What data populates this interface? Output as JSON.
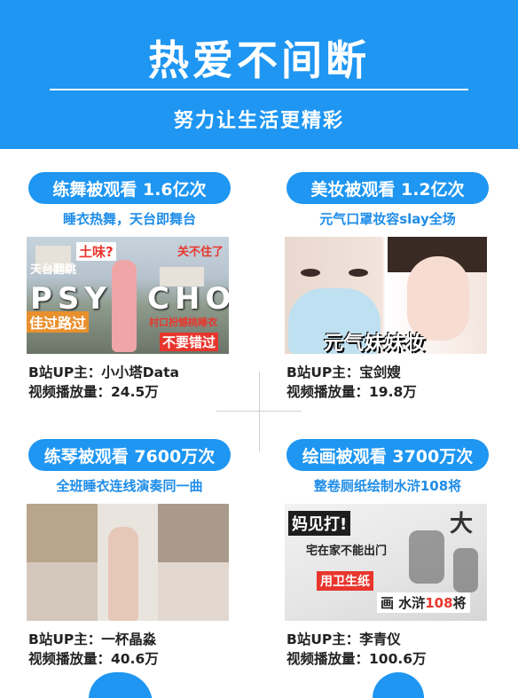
{
  "header": {
    "title": "热爱不间断",
    "subtitle": "努力让生活更精彩"
  },
  "cards": [
    {
      "pill": "练舞被观看 1.6亿次",
      "caption": "睡衣热舞，天台即舞台",
      "thumb_text": [
        "土味?",
        "关不住了",
        "天台翻跳",
        "PSY",
        "CHO",
        "佳过路过",
        "村口扮憾桃睡衣",
        "不要错过"
      ],
      "up": "B站UP主：小小塔Data",
      "plays": "视频播放量：24.5万"
    },
    {
      "pill": "美妆被观看 1.2亿次",
      "caption": "元气口罩妆容slay全场",
      "thumb_text": [
        "元气妹妹妆"
      ],
      "up": "B站UP主：宝剑嫂",
      "plays": "视频播放量：19.8万"
    },
    {
      "pill": "练琴被观看 7600万次",
      "caption": "全班睡衣连线演奏同一曲",
      "thumb_text": [],
      "up": "B站UP主：一杯晶淼",
      "plays": "视频播放量：40.6万"
    },
    {
      "pill": "绘画被观看 3700万次",
      "caption": "整卷厕纸绘制水浒108将",
      "thumb_text": [
        "妈见打!",
        "宅在家不能出门",
        "用卫生纸",
        "画 水浒",
        "108",
        "将",
        "大"
      ],
      "up": "B站UP主：李青仪",
      "plays": "视频播放量：100.6万"
    }
  ],
  "colors": {
    "brand_blue": "#1e96f2",
    "caption_blue": "#1e8ce8",
    "accent_red": "#e8362d"
  }
}
